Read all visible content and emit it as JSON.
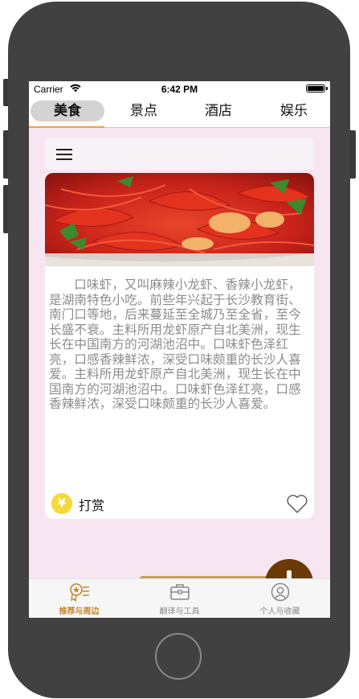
{
  "status_bar": {
    "carrier": "Carrier",
    "time": "6:42 PM"
  },
  "top_tabs": [
    {
      "label": "美食",
      "active": true
    },
    {
      "label": "景点",
      "active": false
    },
    {
      "label": "酒店",
      "active": false
    },
    {
      "label": "娱乐",
      "active": false
    }
  ],
  "menu": {
    "icon": "hamburger-icon"
  },
  "card": {
    "photo": "crayfish-dish-photo",
    "description": "口味虾，又叫麻辣小龙虾、香辣小龙虾，是湖南特色小吃。前些年兴起于长沙教育街、南门口等地，后来蔓延至全城乃至全省，至今长盛不衰。主料所用龙虾原产自北美洲，现生长在中国南方的河湖池沼中。口味虾色泽红亮，口感香辣鲜浓，深受口味颇重的长沙人喜爱。主料所用龙虾原产自北美洲，现生长在中国南方的河湖池沼中。口味虾色泽红亮，口感香辣鲜浓，深受口味颇重的长沙人喜爱。",
    "reward_symbol": "¥",
    "reward_label": "打赏",
    "like_icon": "heart-outline-icon"
  },
  "fab": {
    "icon": "plus-icon"
  },
  "bottom_tabs": [
    {
      "label": "推荐与周边",
      "icon": "recommend-badge-icon",
      "active": true
    },
    {
      "label": "翻译与工具",
      "icon": "toolbox-icon",
      "active": false
    },
    {
      "label": "个人与收藏",
      "icon": "person-icon",
      "active": false
    }
  ],
  "colors": {
    "accent": "#c7862c",
    "tab_underline": "#f0a044",
    "content_bg": "#f7e6f1",
    "fab": "#6b3a06",
    "phone_frame": "#414141"
  }
}
